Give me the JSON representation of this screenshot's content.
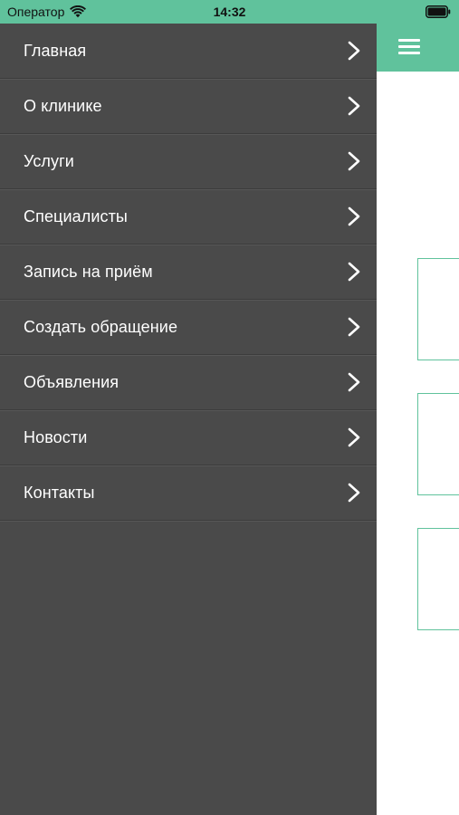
{
  "status_bar": {
    "carrier": "Оператор",
    "time": "14:32",
    "wifi_icon": "wifi-icon",
    "battery_icon": "battery-icon"
  },
  "header": {
    "menu_icon": "hamburger-icon",
    "accent_color": "#60c29c"
  },
  "drawer": {
    "background_color": "#4a4a4a",
    "items": [
      {
        "label": "Главная",
        "icon": "chevron-right-icon"
      },
      {
        "label": "О клинике",
        "icon": "chevron-right-icon"
      },
      {
        "label": "Услуги",
        "icon": "chevron-right-icon"
      },
      {
        "label": "Специалисты",
        "icon": "chevron-right-icon"
      },
      {
        "label": "Запись на приём",
        "icon": "chevron-right-icon"
      },
      {
        "label": "Создать обращение",
        "icon": "chevron-right-icon"
      },
      {
        "label": "Объявления",
        "icon": "chevron-right-icon"
      },
      {
        "label": "Новости",
        "icon": "chevron-right-icon"
      },
      {
        "label": "Контакты",
        "icon": "chevron-right-icon"
      }
    ]
  }
}
